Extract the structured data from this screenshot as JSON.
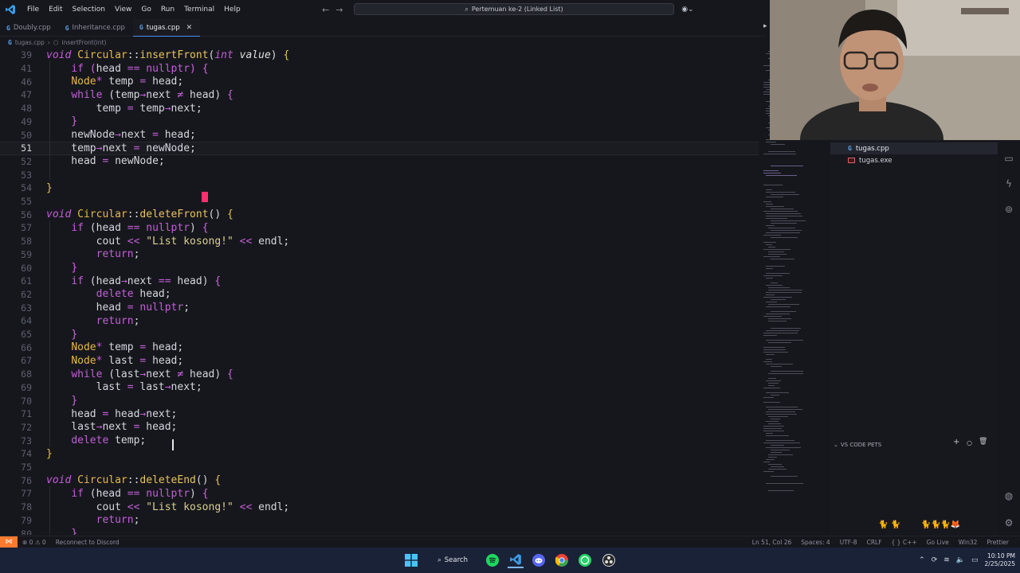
{
  "menu": [
    "File",
    "Edit",
    "Selection",
    "View",
    "Go",
    "Run",
    "Terminal",
    "Help"
  ],
  "search_box": "Pertemuan ke-2 (Linked List)",
  "tabs": [
    {
      "label": "Doubly.cpp",
      "active": false
    },
    {
      "label": "Inheritance.cpp",
      "active": false
    },
    {
      "label": "tugas.cpp",
      "active": true
    }
  ],
  "breadcrumb": {
    "file": "tugas.cpp",
    "symbol": "insertFront(int)"
  },
  "editor": {
    "current_line": 51,
    "lines": [
      {
        "n": "39",
        "html": "<span class=\"ty\">void</span> <span class=\"cls\">Circular</span>::<span class=\"fn\">insertFront</span>(<span class=\"ty\">int</span> <span class=\"ip\">value</span>) <span class=\"br1\">{</span>"
      },
      {
        "n": "41",
        "html": "    <span class=\"kw\">if</span> <span class=\"br2\">(</span>head <span class=\"pn\">==</span> <span class=\"kw\">nullptr</span><span class=\"br2\">)</span> <span class=\"br2\">{</span>"
      },
      {
        "n": "46",
        "html": "    <span class=\"cls\">Node</span><span class=\"pn\">*</span> temp <span class=\"pn\">=</span> head;"
      },
      {
        "n": "47",
        "html": "    <span class=\"kw\">while</span> (temp<span class=\"pn\">→</span>next <span class=\"pn\">≠</span> head) <span class=\"br2\">{</span>"
      },
      {
        "n": "48",
        "html": "        temp <span class=\"pn\">=</span> temp<span class=\"pn\">→</span>next;"
      },
      {
        "n": "49",
        "html": "    <span class=\"br2\">}</span>"
      },
      {
        "n": "50",
        "html": "    newNode<span class=\"pn\">→</span>next <span class=\"pn\">=</span> head;"
      },
      {
        "n": "51",
        "html": "    temp<span class=\"pn\">→</span>next <span class=\"pn\">=</span> newNode;"
      },
      {
        "n": "52",
        "html": "    head <span class=\"pn\">=</span> newNode;"
      },
      {
        "n": "53",
        "html": ""
      },
      {
        "n": "54",
        "html": "<span class=\"br1\">}</span>"
      },
      {
        "n": "55",
        "html": ""
      },
      {
        "n": "56",
        "html": "<span class=\"ty\">void</span> <span class=\"cls\">Circular</span>::<span class=\"fn\">deleteFront</span>() <span class=\"br1\">{</span>"
      },
      {
        "n": "57",
        "html": "    <span class=\"kw\">if</span> (head <span class=\"pn\">==</span> <span class=\"kw\">nullptr</span>) <span class=\"br2\">{</span>"
      },
      {
        "n": "58",
        "html": "        cout <span class=\"pn\">&lt;&lt;</span> <span class=\"str\">\"List kosong!\"</span> <span class=\"pn\">&lt;&lt;</span> endl;"
      },
      {
        "n": "59",
        "html": "        <span class=\"kw\">return</span>;"
      },
      {
        "n": "60",
        "html": "    <span class=\"br2\">}</span>"
      },
      {
        "n": "61",
        "html": "    <span class=\"kw\">if</span> (head<span class=\"pn\">→</span>next <span class=\"pn\">==</span> head) <span class=\"br2\">{</span>"
      },
      {
        "n": "62",
        "html": "        <span class=\"kw\">delete</span> head;"
      },
      {
        "n": "63",
        "html": "        head <span class=\"pn\">=</span> <span class=\"kw\">nullptr</span>;"
      },
      {
        "n": "64",
        "html": "        <span class=\"kw\">return</span>;"
      },
      {
        "n": "65",
        "html": "    <span class=\"br2\">}</span>"
      },
      {
        "n": "66",
        "html": "    <span class=\"cls\">Node</span><span class=\"pn\">*</span> temp <span class=\"pn\">=</span> head;"
      },
      {
        "n": "67",
        "html": "    <span class=\"cls\">Node</span><span class=\"pn\">*</span> last <span class=\"pn\">=</span> head;"
      },
      {
        "n": "68",
        "html": "    <span class=\"kw\">while</span> (last<span class=\"pn\">→</span>next <span class=\"pn\">≠</span> head) <span class=\"br2\">{</span>"
      },
      {
        "n": "69",
        "html": "        last <span class=\"pn\">=</span> last<span class=\"pn\">→</span>next;"
      },
      {
        "n": "70",
        "html": "    <span class=\"br2\">}</span>"
      },
      {
        "n": "71",
        "html": "    head <span class=\"pn\">=</span> head<span class=\"pn\">→</span>next;"
      },
      {
        "n": "72",
        "html": "    last<span class=\"pn\">→</span>next <span class=\"pn\">=</span> head;"
      },
      {
        "n": "73",
        "html": "    <span class=\"kw\">delete</span> temp;"
      },
      {
        "n": "74",
        "html": "<span class=\"br1\">}</span>"
      },
      {
        "n": "75",
        "html": ""
      },
      {
        "n": "76",
        "html": "<span class=\"ty\">void</span> <span class=\"cls\">Circular</span>::<span class=\"fn\">deleteEnd</span>() <span class=\"br1\">{</span>"
      },
      {
        "n": "77",
        "html": "    <span class=\"kw\">if</span> (head <span class=\"pn\">==</span> <span class=\"kw\">nullptr</span>) <span class=\"br2\">{</span>"
      },
      {
        "n": "78",
        "html": "        cout <span class=\"pn\">&lt;&lt;</span> <span class=\"str\">\"List kosong!\"</span> <span class=\"pn\">&lt;&lt;</span> endl;"
      },
      {
        "n": "79",
        "html": "        <span class=\"kw\">return</span>;"
      },
      {
        "n": "80",
        "html": "    <span class=\"br2\">}</span>"
      }
    ]
  },
  "explorer": {
    "files": [
      {
        "name": "tugas.cpp",
        "type": "cpp",
        "selected": true
      },
      {
        "name": "tugas.exe",
        "type": "exe",
        "selected": false
      }
    ],
    "pets_section": "VS CODE PETS"
  },
  "statusbar": {
    "problems": "⊗ 0  ⚠ 0",
    "discord": "Reconnect to Discord",
    "position": "Ln 51, Col 26",
    "spaces": "Spaces: 4",
    "encoding": "UTF-8",
    "eol": "CRLF",
    "language": "{ } C++",
    "golive": "Go Live",
    "platform": "Win32",
    "prettier": "Prettier"
  },
  "taskbar": {
    "search_label": "Search",
    "time": "10:10 PM",
    "date": "2/25/2025"
  },
  "colors": {
    "accent": "#4a8ff0",
    "remote_badge": "#ff7a2f",
    "cursor": "#ff2f6d"
  }
}
